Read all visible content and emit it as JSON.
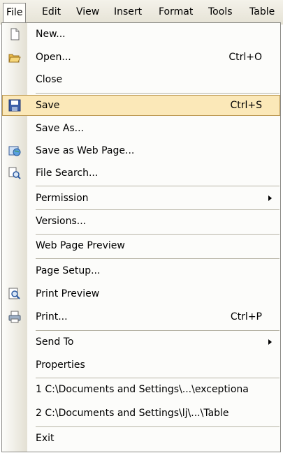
{
  "menubar": {
    "items": [
      {
        "label": "File",
        "active": true
      },
      {
        "label": "Edit"
      },
      {
        "label": "View"
      },
      {
        "label": "Insert"
      },
      {
        "label": "Format"
      },
      {
        "label": "Tools"
      },
      {
        "label": "Table"
      }
    ]
  },
  "file_menu": {
    "items": [
      {
        "label": "New...",
        "icon": "new-document-icon"
      },
      {
        "label": "Open...",
        "shortcut": "Ctrl+O",
        "icon": "open-folder-icon"
      },
      {
        "label": "Close"
      },
      {
        "label": "Save",
        "shortcut": "Ctrl+S",
        "icon": "floppy-disk-icon",
        "highlighted": true
      },
      {
        "label": "Save As..."
      },
      {
        "label": "Save as Web Page...",
        "icon": "web-page-icon"
      },
      {
        "label": "File Search...",
        "icon": "file-search-icon"
      },
      {
        "label": "Permission",
        "submenu": true
      },
      {
        "label": "Versions..."
      },
      {
        "label": "Web Page Preview"
      },
      {
        "label": "Page Setup..."
      },
      {
        "label": "Print Preview",
        "icon": "print-preview-icon"
      },
      {
        "label": "Print...",
        "shortcut": "Ctrl+P",
        "icon": "printer-icon"
      },
      {
        "label": "Send To",
        "submenu": true
      },
      {
        "label": "Properties"
      },
      {
        "label": "1 C:\\Documents and Settings\\...\\exceptiona"
      },
      {
        "label": "2 C:\\Documents and Settings\\lj\\...\\Table"
      },
      {
        "label": "Exit"
      }
    ]
  },
  "colors": {
    "highlight_bg": "#fbe8b8",
    "highlight_border": "#bd9a54",
    "menubar_bg": "#ece9d8"
  }
}
